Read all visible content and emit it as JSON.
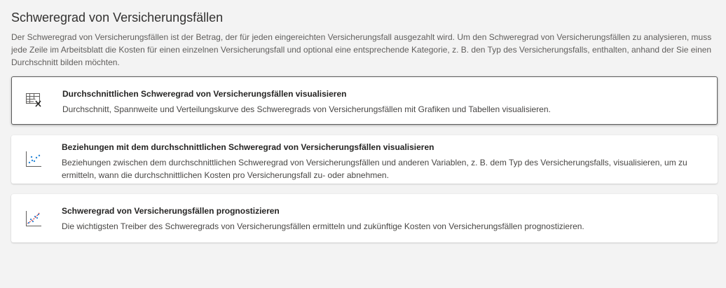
{
  "header": {
    "title": "Schweregrad von Versicherungsfällen",
    "description": "Der Schweregrad von Versicherungsfällen ist der Betrag, der für jeden eingereichten Versicherungsfall ausgezahlt wird. Um den Schweregrad von Versicherungsfällen zu analysieren, muss jede Zeile im Arbeitsblatt die Kosten für einen einzelnen Versicherungsfall und optional eine entsprechende Kategorie, z. B. den Typ des Versicherungsfalls, enthalten, anhand der Sie einen Durchschnitt bilden möchten."
  },
  "cards": [
    {
      "icon": "table-x-icon",
      "title": "Durchschnittlichen Schweregrad von Versicherungsfällen visualisieren",
      "description": "Durchschnitt, Spannweite und Verteilungskurve des Schweregrads von Versicherungsfällen mit Grafiken und Tabellen visualisieren.",
      "selected": true
    },
    {
      "icon": "scatter-plot-icon",
      "title": "Beziehungen mit dem durchschnittlichen Schweregrad von Versicherungsfällen visualisieren",
      "description": "Beziehungen zwischen dem durchschnittlichen Schweregrad von Versicherungsfällen und anderen Variablen, z. B. dem Typ des Versicherungsfalls, visualisieren, um zu ermitteln, wann die durchschnittlichen Kosten pro Versicherungsfall zu- oder abnehmen.",
      "selected": false
    },
    {
      "icon": "forecast-chart-icon",
      "title": "Schweregrad von Versicherungsfällen prognostizieren",
      "description": "Die wichtigsten Treiber des Schweregrads von Versicherungsfällen ermitteln und zukünftige Kosten von Versicherungsfällen prognostizieren.",
      "selected": false
    }
  ],
  "colors": {
    "background": "#f3f3f3",
    "card": "#ffffff",
    "selected_border": "#5c5c5c",
    "accent_blue": "#2b88d8",
    "accent_red": "#d13438"
  }
}
